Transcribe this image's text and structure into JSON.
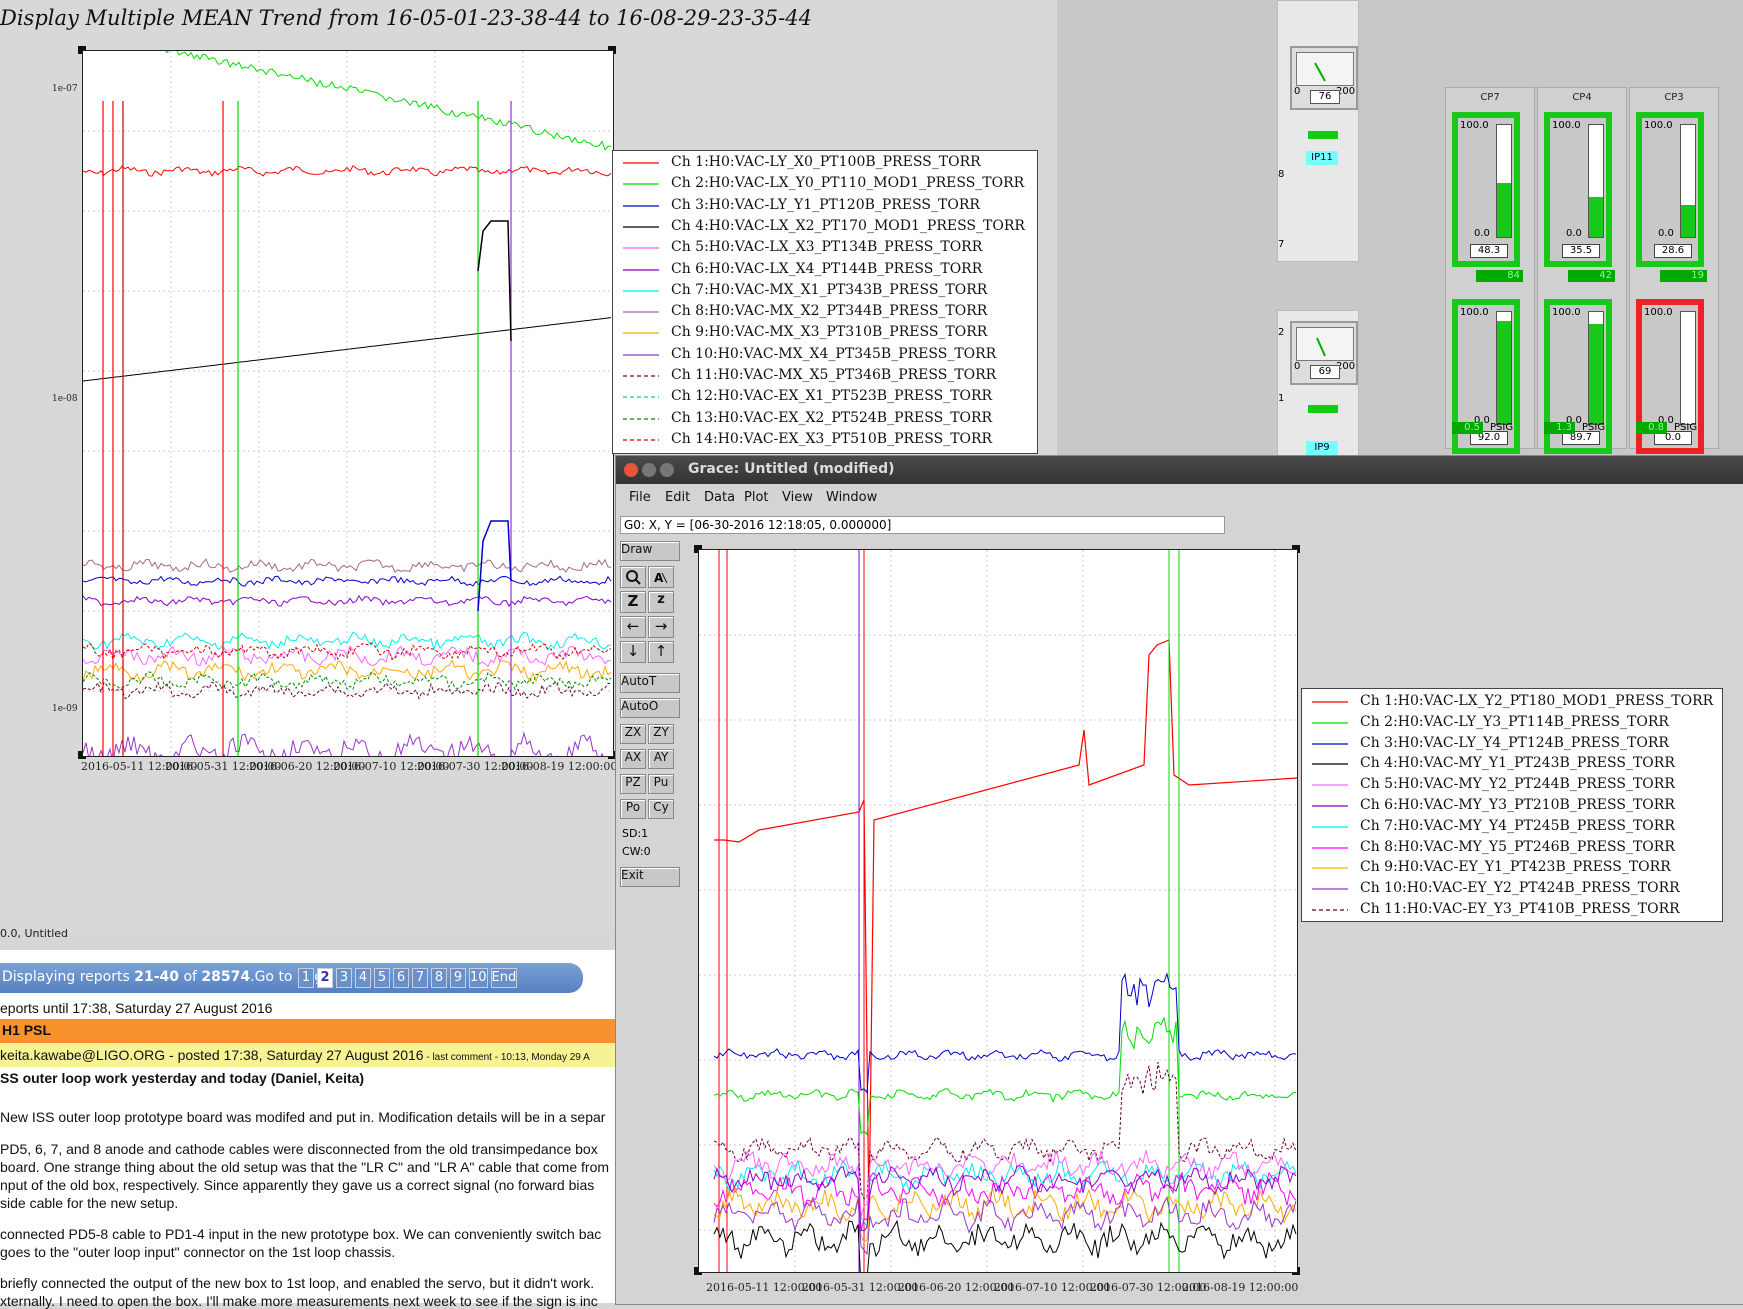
{
  "trend": {
    "title": "Display Multiple MEAN Trend from 16-05-01-23-38-44 to 16-08-29-23-35-44",
    "yticks": [
      "1e-07",
      "1e-08",
      "1e-09"
    ],
    "xticks": [
      "2016-05-11 12:00:00",
      "2016-05-31 12:00:00",
      "2016-06-20 12:00:00",
      "2016-07-10 12:00:00",
      "2016-07-30 12:00:00",
      "2016-08-19 12:00:00"
    ],
    "legend": [
      {
        "label": "Ch 1:H0:VAC-LY_X0_PT100B_PRESS_TORR",
        "color": "#ff0000",
        "dash": false
      },
      {
        "label": "Ch 2:H0:VAC-LX_Y0_PT110_MOD1_PRESS_TORR",
        "color": "#00dd00",
        "dash": false
      },
      {
        "label": "Ch 3:H0:VAC-LY_Y1_PT120B_PRESS_TORR",
        "color": "#0000cc",
        "dash": false
      },
      {
        "label": "Ch 4:H0:VAC-LX_X2_PT170_MOD1_PRESS_TORR",
        "color": "#000000",
        "dash": false
      },
      {
        "label": "Ch 5:H0:VAC-LX_X3_PT134B_PRESS_TORR",
        "color": "#ff66ff",
        "dash": false
      },
      {
        "label": "Ch 6:H0:VAC-LX_X4_PT144B_PRESS_TORR",
        "color": "#8800cc",
        "dash": false
      },
      {
        "label": "Ch 7:H0:VAC-MX_X1_PT343B_PRESS_TORR",
        "color": "#00eeee",
        "dash": false
      },
      {
        "label": "Ch 8:H0:VAC-MX_X2_PT344B_PRESS_TORR",
        "color": "#aa66aa",
        "dash": false
      },
      {
        "label": "Ch 9:H0:VAC-MX_X3_PT310B_PRESS_TORR",
        "color": "#ffaa00",
        "dash": false
      },
      {
        "label": "Ch 10:H0:VAC-MX_X4_PT345B_PRESS_TORR",
        "color": "#9933cc",
        "dash": false
      },
      {
        "label": "Ch 11:H0:VAC-MX_X5_PT346B_PRESS_TORR",
        "color": "#660033",
        "dash": true
      },
      {
        "label": "Ch 12:H0:VAC-EX_X1_PT523B_PRESS_TORR",
        "color": "#00ccaa",
        "dash": true
      },
      {
        "label": "Ch 13:H0:VAC-EX_X2_PT524B_PRESS_TORR",
        "color": "#008800",
        "dash": true
      },
      {
        "label": "Ch 14:H0:VAC-EX_X3_PT510B_PRESS_TORR",
        "color": "#cc0000",
        "dash": true
      }
    ],
    "status": "0.0, Untitled"
  },
  "gauges": {
    "dials": [
      {
        "min": "0",
        "max": "200",
        "value": "76",
        "label": "IP11",
        "side_a": "8",
        "side_b": "7"
      },
      {
        "min": "0",
        "max": "200",
        "value": "69",
        "label": "IP9",
        "side_a": "2",
        "side_b": "1"
      }
    ],
    "cp": [
      {
        "name": "CP7",
        "top": "100.0",
        "bottom": "0.0",
        "reading1": "48.3",
        "level1": 0.48,
        "box1": "84",
        "reading2": "92.0",
        "level2": 0.92,
        "psig": "0.5",
        "alarm": false
      },
      {
        "name": "CP4",
        "top": "100.0",
        "bottom": "0.0",
        "reading1": "35.5",
        "level1": 0.355,
        "box1": "42",
        "reading2": "89.7",
        "level2": 0.897,
        "psig": "1.3",
        "alarm": false
      },
      {
        "name": "CP3",
        "top": "100.0",
        "bottom": "0.0",
        "reading1": "28.6",
        "level1": 0.286,
        "box1": "19",
        "reading2": "0.0",
        "level2": 0.0,
        "psig": "0.8",
        "alarm": true
      }
    ],
    "psig_unit": "PSIG"
  },
  "elog": {
    "pager_prefix": "Displaying reports ",
    "pager_range": "21-40",
    "pager_of": " of ",
    "pager_total": "28574",
    "pager_goto": ".Go to page",
    "pages": [
      "1",
      "2",
      "3",
      "4",
      "5",
      "6",
      "7",
      "8",
      "9",
      "10",
      "End"
    ],
    "reports_until": "eports until 17:38, Saturday 27 August 2016",
    "section": "H1 PSL",
    "author_line": "keita.kawabe@LIGO.ORG - posted 17:38, Saturday 27 August 2016",
    "last_comment": " - last comment - 10:13, Monday 29 A",
    "post_title": "SS outer loop work yesterday and today (Daniel, Keita)",
    "lines": [
      "New ISS outer loop prototype board was modifed and put in. Modification details will be in a separ",
      "PD5, 6, 7, and 8 anode and cathode cables were disconnected from the old transimpedance box",
      "board. One strange thing about the old setup was that the \"LR C\" and \"LR A\" cable that come from",
      "nput of the old box, respectively. Since apparently they gave us a correct signal (no forward bias",
      "side cable for the new setup.",
      " connected PD5-8 cable to PD1-4 input in the new prototype box. We can conveniently switch bac",
      "goes to the \"outer loop input\" connector on the 1st loop chassis.",
      " briefly connected the output of the new box to 1st loop, and enabled the servo, but it didn't work.",
      "xternally. I need to open the box. I'll make more measurements next week to see if the sign is inc"
    ]
  },
  "grace": {
    "title": "Grace: Untitled (modified)",
    "menu": [
      "File",
      "Edit",
      "Data",
      "Plot",
      "View",
      "Window"
    ],
    "coord": "G0: X, Y = [06-30-2016 12:18:05, 0.000000]",
    "tools": {
      "draw": "Draw",
      "autot": "AutoT",
      "autoo": "AutoO",
      "zx": "ZX",
      "zy": "ZY",
      "ax": "AX",
      "ay": "AY",
      "pz": "PZ",
      "pu": "Pu",
      "po": "Po",
      "cy": "Cy",
      "sd": "SD:1",
      "cw": "CW:0",
      "exit": "Exit",
      "zoom_glyph": "Z",
      "small_z_glyph": "z"
    },
    "xticks": [
      "2016-05-11 12:00:00",
      "2016-05-31 12:00:00",
      "2016-06-20 12:00:00",
      "2016-07-10 12:00:00",
      "2016-07-30 12:00:00",
      "2016-08-19 12:00:00"
    ],
    "legend": [
      {
        "label": "Ch 1:H0:VAC-LX_Y2_PT180_MOD1_PRESS_TORR",
        "color": "#ff0000",
        "dash": false
      },
      {
        "label": "Ch 2:H0:VAC-LY_Y3_PT114B_PRESS_TORR",
        "color": "#00dd00",
        "dash": false
      },
      {
        "label": "Ch 3:H0:VAC-LY_Y4_PT124B_PRESS_TORR",
        "color": "#0000cc",
        "dash": false
      },
      {
        "label": "Ch 4:H0:VAC-MY_Y1_PT243B_PRESS_TORR",
        "color": "#000000",
        "dash": false
      },
      {
        "label": "Ch 5:H0:VAC-MY_Y2_PT244B_PRESS_TORR",
        "color": "#ff66ff",
        "dash": false
      },
      {
        "label": "Ch 6:H0:VAC-MY_Y3_PT210B_PRESS_TORR",
        "color": "#8800cc",
        "dash": false
      },
      {
        "label": "Ch 7:H0:VAC-MY_Y4_PT245B_PRESS_TORR",
        "color": "#00eeee",
        "dash": false
      },
      {
        "label": "Ch 8:H0:VAC-MY_Y5_PT246B_PRESS_TORR",
        "color": "#ff00ff",
        "dash": false
      },
      {
        "label": "Ch 9:H0:VAC-EY_Y1_PT423B_PRESS_TORR",
        "color": "#ffaa00",
        "dash": false
      },
      {
        "label": "Ch 10:H0:VAC-EY_Y2_PT424B_PRESS_TORR",
        "color": "#9933cc",
        "dash": false
      },
      {
        "label": "Ch 11:H0:VAC-EY_Y3_PT410B_PRESS_TORR",
        "color": "#660033",
        "dash": true
      }
    ]
  }
}
